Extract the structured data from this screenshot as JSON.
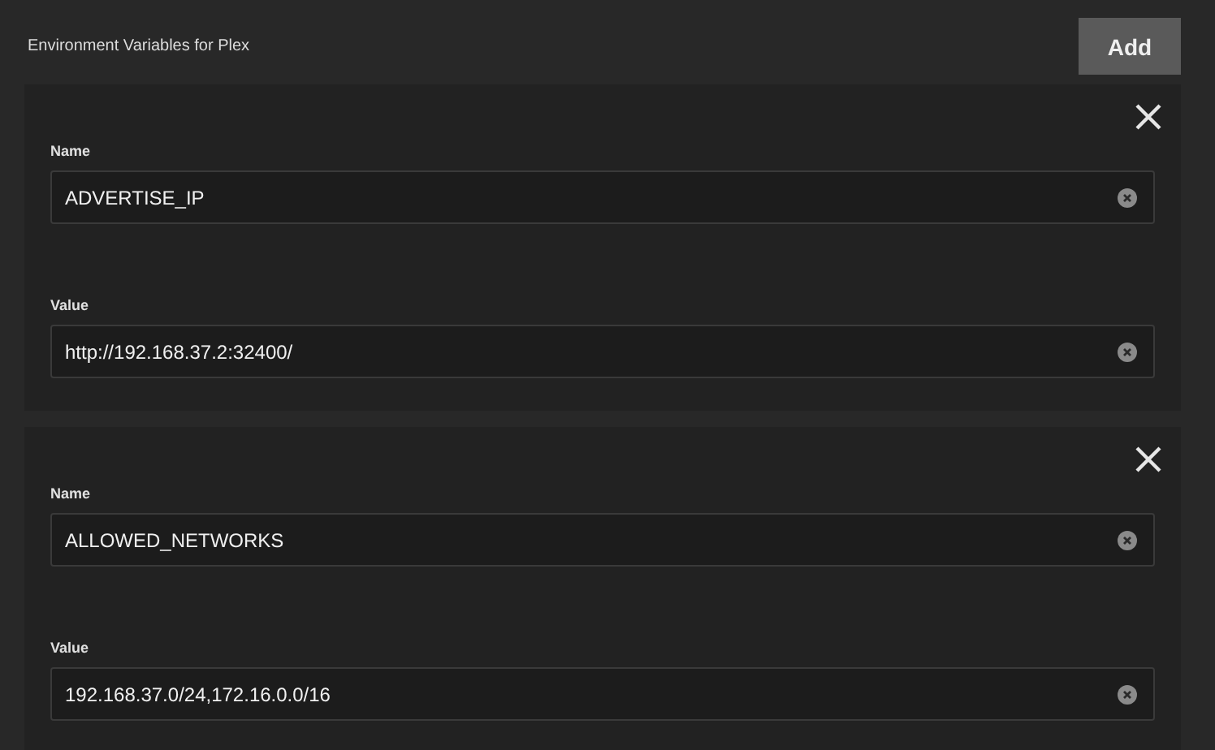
{
  "header": {
    "title": "Environment Variables for Plex",
    "add_button": "Add"
  },
  "variables": [
    {
      "name_label": "Name",
      "name": "ADVERTISE_IP",
      "value_label": "Value",
      "value": "http://192.168.37.2:32400/"
    },
    {
      "name_label": "Name",
      "name": "ALLOWED_NETWORKS",
      "value_label": "Value",
      "value": "192.168.37.0/24,172.16.0.0/16"
    }
  ]
}
